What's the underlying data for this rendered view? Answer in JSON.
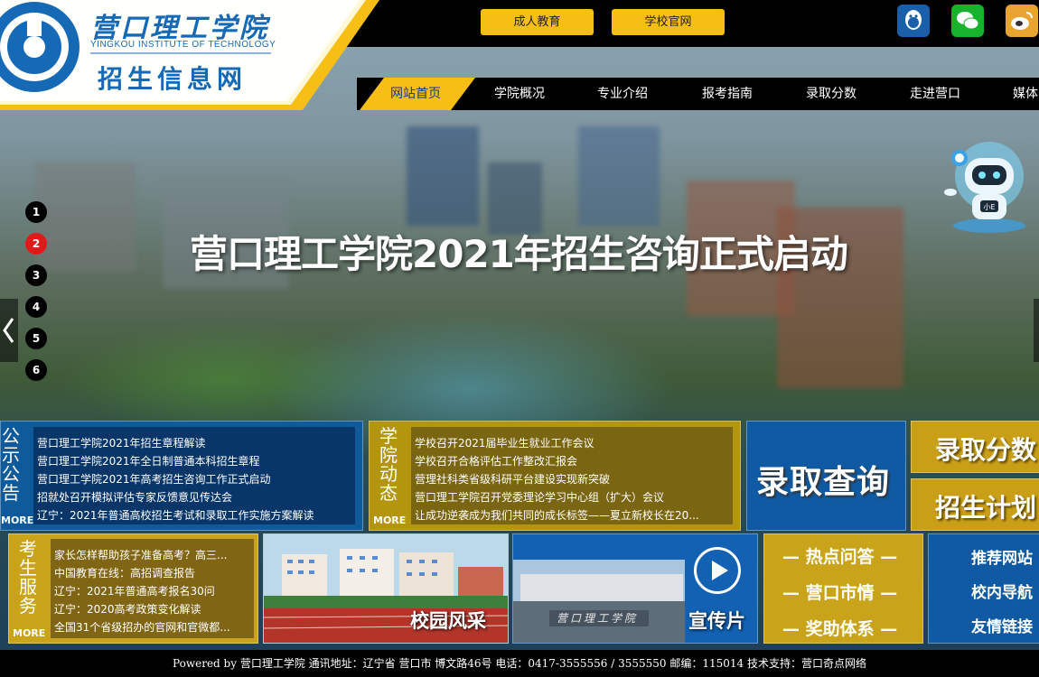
{
  "header": {
    "school_name": "营口理工学院",
    "school_name_en": "YINGKOU INSTITUTE OF TECHNOLOGY",
    "site_name": "招生信息网",
    "quick_links": [
      "成人教育",
      "学校官网"
    ],
    "social_icons": [
      "qq-icon",
      "wechat-icon",
      "weibo-icon"
    ]
  },
  "nav": {
    "items": [
      "网站首页",
      "学院概况",
      "专业介绍",
      "报考指南",
      "录取分数",
      "走进营口",
      "媒体"
    ],
    "active_index": 0
  },
  "banner": {
    "headline": "营口理工学院2021年招生咨询正式启动",
    "slides": [
      "1",
      "2",
      "3",
      "4",
      "5",
      "6"
    ],
    "active_slide": 2,
    "robot_label": "小E"
  },
  "announcements": {
    "title": "公示公告",
    "more": "MORE",
    "items": [
      "营口理工学院2021年招生章程解读",
      "营口理工学院2021年全日制普通本科招生章程",
      "营口理工学院2021年高考招生咨询工作正式启动",
      "招就处召开模拟评估专家反馈意见传达会",
      "辽宁：2021年普通高校招生考试和录取工作实施方案解读"
    ]
  },
  "news": {
    "title": "学院动态",
    "more": "MORE",
    "items": [
      "学校召开2021届毕业生就业工作会议",
      "学校召开合格评估工作整改汇报会",
      "营理社科类省级科研平台建设实现新突破",
      "营口理工学院召开党委理论学习中心组（扩大）会议",
      "让成功逆袭成为我们共同的成长标签——夏立新校长在20..."
    ]
  },
  "tiles": {
    "query": "录取查询",
    "score": "录取分数",
    "plan": "招生计划"
  },
  "student_service": {
    "title": "考生服务",
    "more": "MORE",
    "items": [
      "家长怎样帮助孩子准备高考？高三...",
      "中国教育在线：高招调查报告",
      "辽宁：2021年普通高考报名30问",
      "辽宁：2020高考政策变化解读",
      "全国31个省级招办的官网和官微都..."
    ]
  },
  "media": {
    "campus_label": "校园风采",
    "video_label": "宣传片",
    "gate_text": "营口理工学院"
  },
  "faq": {
    "rows": [
      "— 热点问答 —",
      "— 营口市情 —",
      "— 奖助体系 —"
    ]
  },
  "links": {
    "rows": [
      "推荐网站",
      "校内导航",
      "友情链接"
    ]
  },
  "footer": {
    "text": "Powered by 营口理工学院   通讯地址：辽宁省 营口市 博文路46号   电话：0417-3555556 / 3555550   邮编：115014   技术支持：营口奇点网络"
  },
  "colors": {
    "brand_blue": "#1569b5",
    "brand_yellow": "#f7be15",
    "active_dot": "#e0191a"
  }
}
